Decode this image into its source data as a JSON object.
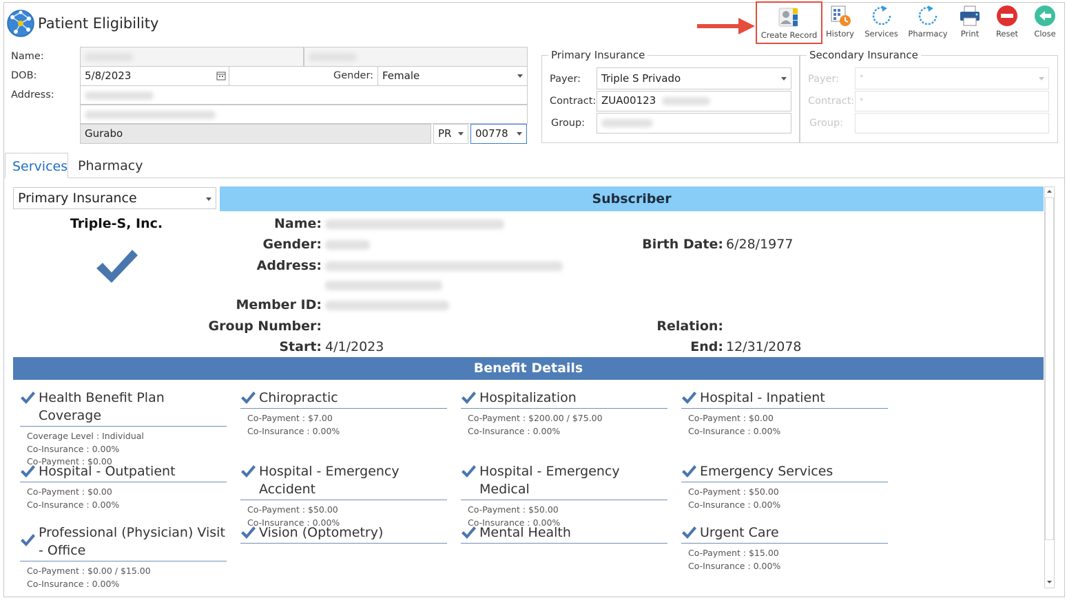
{
  "window": {
    "title": "Patient Eligibility"
  },
  "toolbar": {
    "create_record": "Create Record",
    "history": "History",
    "services": "Services",
    "pharmacy": "Pharmacy",
    "print": "Print",
    "reset": "Reset",
    "close": "Close"
  },
  "patient": {
    "name_label": "Name:",
    "dob_label": "DOB:",
    "dob_value": "5/8/2023",
    "gender_label": "Gender:",
    "gender_value": "Female",
    "address_label": "Address:",
    "city": "Gurabo",
    "state": "PR",
    "zip": "00778"
  },
  "primary_insurance": {
    "title": "Primary Insurance",
    "payer_label": "Payer:",
    "payer_value": "Triple S Privado",
    "contract_label": "Contract:",
    "contract_value": "ZUA00123",
    "group_label": "Group:"
  },
  "secondary_insurance": {
    "title": "Secondary Insurance",
    "payer_label": "Payer:",
    "payer_value": "*",
    "contract_label": "Contract:",
    "contract_value": "*",
    "group_label": "Group:"
  },
  "tabs": [
    {
      "label": "Services"
    },
    {
      "label": "Pharmacy"
    }
  ],
  "insurance_selector": {
    "value": "Primary Insurance"
  },
  "carrier": {
    "name": "Triple-S, Inc."
  },
  "subscriber": {
    "header": "Subscriber",
    "name_label": "Name:",
    "gender_label": "Gender:",
    "address_label": "Address:",
    "member_id_label": "Member ID:",
    "group_number_label": "Group Number:",
    "start_label": "Start:",
    "start_value": "4/1/2023",
    "birth_date_label": "Birth Date:",
    "birth_date_value": "6/28/1977",
    "relation_label": "Relation:",
    "end_label": "End:",
    "end_value": "12/31/2078"
  },
  "benefit_details": {
    "header": "Benefit Details",
    "items": [
      {
        "title": "Health Benefit Plan Coverage",
        "lines": [
          "Coverage Level : Individual",
          "Co-Insurance : 0.00%",
          "Co-Payment : $0.00"
        ]
      },
      {
        "title": "Chiropractic",
        "lines": [
          "Co-Payment : $7.00",
          "Co-Insurance : 0.00%"
        ]
      },
      {
        "title": "Hospitalization",
        "lines": [
          "Co-Payment : $200.00 / $75.00",
          "Co-Insurance : 0.00%"
        ]
      },
      {
        "title": "Hospital - Inpatient",
        "lines": [
          "Co-Payment : $0.00",
          "Co-Insurance : 0.00%"
        ]
      },
      {
        "title": "Hospital - Outpatient",
        "lines": [
          "Co-Payment : $0.00",
          "Co-Insurance : 0.00%"
        ]
      },
      {
        "title": "Hospital - Emergency Accident",
        "lines": [
          "Co-Payment : $50.00",
          "Co-Insurance : 0.00%"
        ]
      },
      {
        "title": "Hospital - Emergency Medical",
        "lines": [
          "Co-Payment : $50.00",
          "Co-Insurance : 0.00%"
        ]
      },
      {
        "title": "Emergency Services",
        "lines": [
          "Co-Payment : $50.00",
          "Co-Insurance : 0.00%"
        ]
      },
      {
        "title": "Professional (Physician) Visit - Office",
        "lines": [
          "Co-Payment : $0.00 / $15.00",
          "Co-Insurance : 0.00%"
        ]
      },
      {
        "title": "Vision (Optometry)",
        "lines": []
      },
      {
        "title": "Mental Health",
        "lines": []
      },
      {
        "title": "Urgent Care",
        "lines": [
          "Co-Payment : $15.00",
          "Co-Insurance : 0.00%"
        ]
      }
    ]
  },
  "colors": {
    "accent_blue": "#1f6fc1",
    "subscriber_bar": "#87cdf8",
    "benefit_bar": "#4f7db7",
    "check": "#4a76ae",
    "highlight_red": "#e74c3c"
  }
}
